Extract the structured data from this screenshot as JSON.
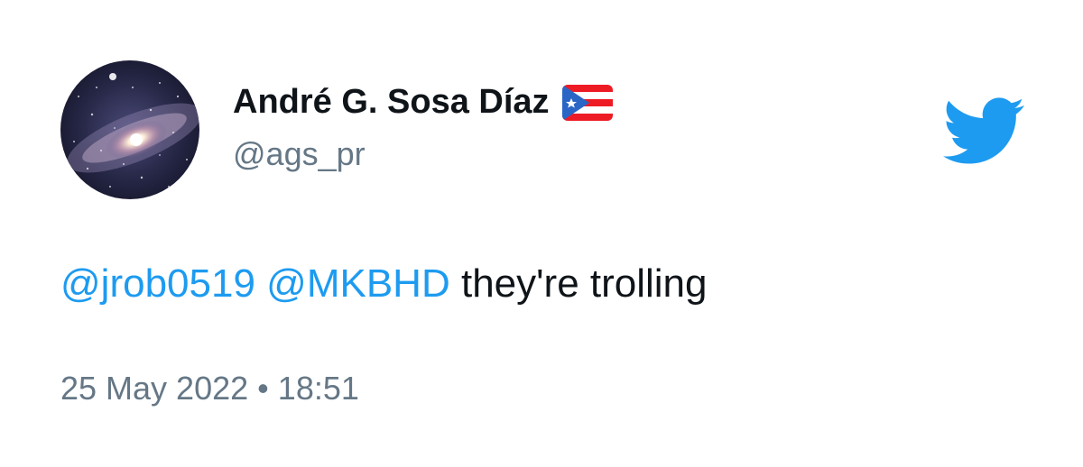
{
  "author": {
    "display_name": "André G. Sosa Díaz",
    "handle": "@ags_pr",
    "avatar_icon": "galaxy-avatar",
    "flag_icon": "puerto-rico-flag-icon"
  },
  "brand": {
    "logo_icon": "twitter-bird-icon",
    "color": "#1d9bf0"
  },
  "tweet": {
    "mention_1": "@jrob0519",
    "mention_2": "@MKBHD",
    "text": "they're trolling"
  },
  "meta": {
    "date": "25 May 2022",
    "separator": "•",
    "time": "18:51"
  },
  "colors": {
    "text": "#0f1419",
    "secondary": "#657786",
    "link": "#1d9bf0"
  }
}
